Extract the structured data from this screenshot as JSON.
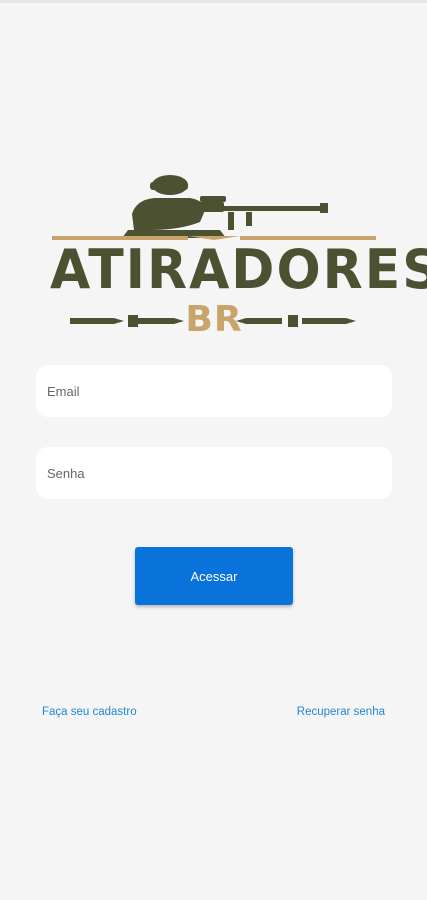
{
  "logo": {
    "title": "ATIRADORES",
    "subtitle": "BR",
    "icon": "sniper-soldier-icon",
    "colors": {
      "olive": "#4b5131",
      "gold": "#c9a46a"
    }
  },
  "form": {
    "email_placeholder": "Email",
    "password_placeholder": "Senha",
    "submit_label": "Acessar"
  },
  "links": {
    "signup": "Faça seu cadastro",
    "recover": "Recuperar senha"
  },
  "colors": {
    "background": "#f5f5f5",
    "primary": "#0a72db",
    "link": "#1e88d6"
  }
}
